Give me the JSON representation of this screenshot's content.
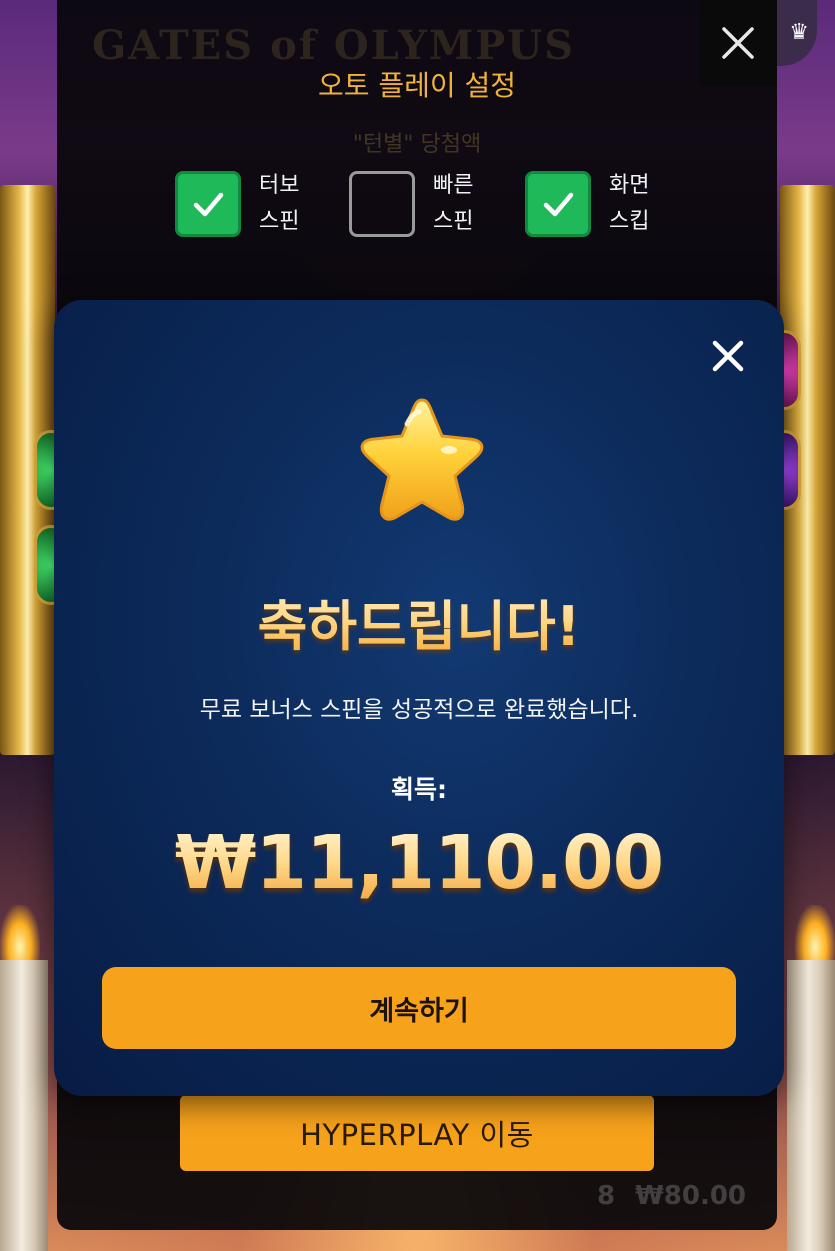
{
  "game": {
    "logo_text": "GATES of OLYMPUS",
    "bet_multiplier": "8",
    "bet_amount": "₩80.00"
  },
  "autoplay": {
    "title": "오토 플레이 설정",
    "winnings_label": "\"턴별\" 당첨액",
    "options": [
      {
        "label_line1": "터보",
        "label_line2": "스핀",
        "checked": true
      },
      {
        "label_line1": "빠른",
        "label_line2": "스핀",
        "checked": false
      },
      {
        "label_line1": "화면",
        "label_line2": "스킵",
        "checked": true
      }
    ],
    "hyperplay_button": "HYPERPLAY 이동"
  },
  "modal": {
    "title": "축하드립니다!",
    "message": "무료 보너스 스핀을 성공적으로 완료했습니다.",
    "win_label": "획득:",
    "win_amount": "₩11,110.00",
    "continue_button": "계속하기"
  },
  "icons": {
    "close": "close-icon",
    "star": "star-icon",
    "check": "check-icon",
    "crown": "crown-icon"
  },
  "colors": {
    "accent_orange": "#f7a21b",
    "checkbox_green": "#1fb95a",
    "gold_text": "#f0b23a",
    "modal_blue": "#0c2a5a"
  }
}
